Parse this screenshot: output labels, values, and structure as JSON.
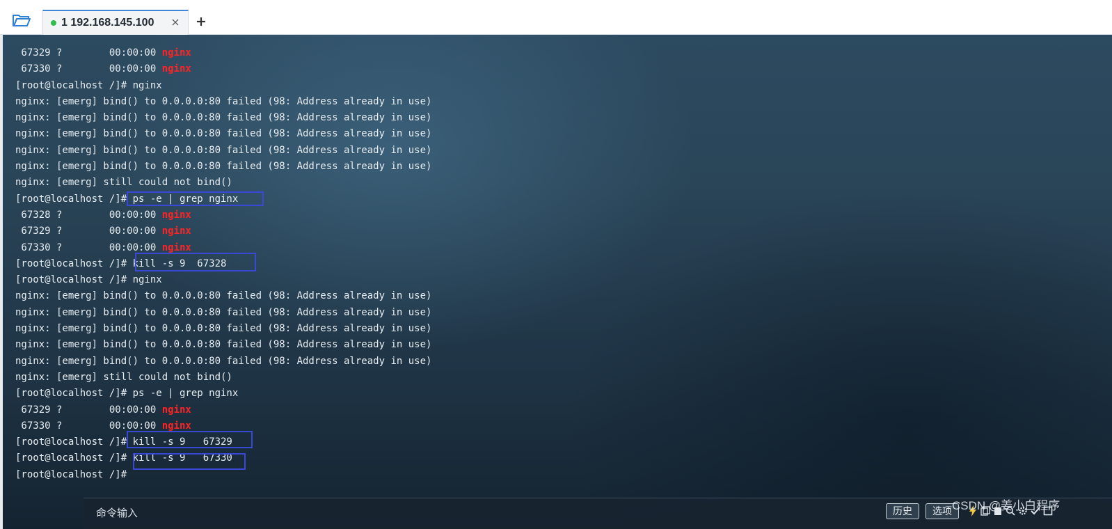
{
  "tabbar": {
    "folder_icon": "folder-open-icon",
    "tab": {
      "label": "1 192.168.145.100",
      "status_color": "#2fbf4a",
      "close_icon": "close-icon"
    },
    "add_icon": "plus-icon"
  },
  "terminal": {
    "highlight_color": "#ff2424",
    "box_color": "#3a48d6",
    "lines": [
      {
        "text": " 67329 ?        00:00:00 ",
        "hl": "nginx"
      },
      {
        "text": " 67330 ?        00:00:00 ",
        "hl": "nginx"
      },
      {
        "text": "[root@localhost /]# nginx"
      },
      {
        "text": "nginx: [emerg] bind() to 0.0.0.0:80 failed (98: Address already in use)"
      },
      {
        "text": "nginx: [emerg] bind() to 0.0.0.0:80 failed (98: Address already in use)"
      },
      {
        "text": "nginx: [emerg] bind() to 0.0.0.0:80 failed (98: Address already in use)"
      },
      {
        "text": "nginx: [emerg] bind() to 0.0.0.0:80 failed (98: Address already in use)"
      },
      {
        "text": "nginx: [emerg] bind() to 0.0.0.0:80 failed (98: Address already in use)"
      },
      {
        "text": "nginx: [emerg] still could not bind()"
      },
      {
        "text": "[root@localhost /]# ps -e | grep nginx"
      },
      {
        "text": " 67328 ?        00:00:00 ",
        "hl": "nginx"
      },
      {
        "text": " 67329 ?        00:00:00 ",
        "hl": "nginx"
      },
      {
        "text": " 67330 ?        00:00:00 ",
        "hl": "nginx"
      },
      {
        "text": "[root@localhost /]# kill -s 9  67328"
      },
      {
        "text": "[root@localhost /]# nginx"
      },
      {
        "text": "nginx: [emerg] bind() to 0.0.0.0:80 failed (98: Address already in use)"
      },
      {
        "text": "nginx: [emerg] bind() to 0.0.0.0:80 failed (98: Address already in use)"
      },
      {
        "text": "nginx: [emerg] bind() to 0.0.0.0:80 failed (98: Address already in use)"
      },
      {
        "text": "nginx: [emerg] bind() to 0.0.0.0:80 failed (98: Address already in use)"
      },
      {
        "text": "nginx: [emerg] bind() to 0.0.0.0:80 failed (98: Address already in use)"
      },
      {
        "text": "nginx: [emerg] still could not bind()"
      },
      {
        "text": "[root@localhost /]# ps -e | grep nginx"
      },
      {
        "text": " 67329 ?        00:00:00 ",
        "hl": "nginx"
      },
      {
        "text": " 67330 ?        00:00:00 ",
        "hl": "nginx"
      },
      {
        "text": "[root@localhost /]# kill -s 9   67329"
      },
      {
        "text": "[root@localhost /]# kill -s 9   67330"
      },
      {
        "text": "[root@localhost /]#"
      }
    ]
  },
  "cmdbar": {
    "input_placeholder": "命令输入",
    "history_label": "历史",
    "options_label": "选项",
    "icons": [
      "lightning-icon",
      "copy-icon",
      "paste-icon",
      "search-icon",
      "settings-icon",
      "check-icon",
      "window-icon"
    ]
  },
  "watermark": "CSDN @姜小白程序"
}
